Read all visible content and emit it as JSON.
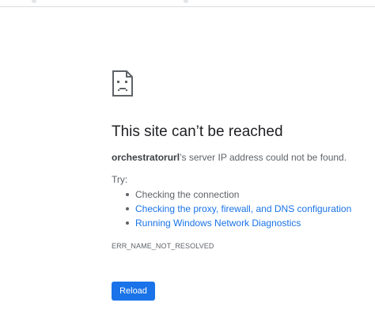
{
  "error_page": {
    "icon": "sad-page-icon",
    "title": "This site can’t be reached",
    "host": "orchestratorurl",
    "description_suffix": "’s server IP address could not be found.",
    "try_label": "Try:",
    "suggestions": [
      {
        "label": "Checking the connection",
        "is_link": false
      },
      {
        "label": "Checking the proxy, firewall, and DNS configuration",
        "is_link": true
      },
      {
        "label": "Running Windows Network Diagnostics",
        "is_link": true
      }
    ],
    "error_code": "ERR_NAME_NOT_RESOLVED",
    "reload_label": "Reload"
  },
  "colors": {
    "title": "#202124",
    "body_text": "#5f6368",
    "link": "#1a73e8",
    "button_bg": "#1a73e8",
    "button_text": "#ffffff"
  }
}
